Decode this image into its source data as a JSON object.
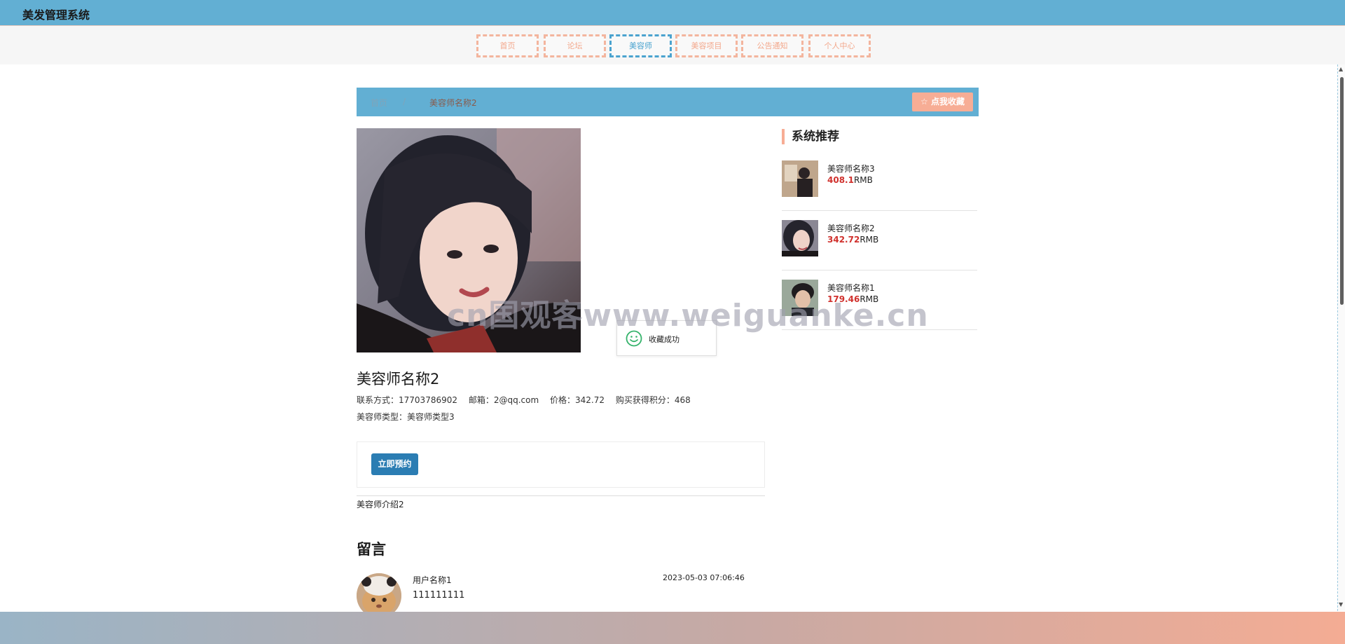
{
  "app": {
    "title": "美发管理系统"
  },
  "nav": {
    "items": [
      {
        "label": "首页",
        "active": false
      },
      {
        "label": "论坛",
        "active": false
      },
      {
        "label": "美容师",
        "active": true
      },
      {
        "label": "美容项目",
        "active": false
      },
      {
        "label": "公告通知",
        "active": false
      },
      {
        "label": "个人中心",
        "active": false
      }
    ]
  },
  "breadcrumb": {
    "home": "首页",
    "separator": "/",
    "current": "美容师名称2"
  },
  "favorite_button": {
    "label": "☆ 点我收藏"
  },
  "detail": {
    "name": "美容师名称2",
    "contact_label": "联系方式：",
    "contact": "17703786902",
    "email_label": "邮箱：",
    "email": "2@qq.com",
    "price_label": "价格：",
    "price": "342.72",
    "points_label": "购买获得积分：",
    "points": "468",
    "type_label": "美容师类型：",
    "type": "美容师类型3",
    "book_label": "立即预约",
    "intro": "美容师介绍2"
  },
  "comments": {
    "title": "留言",
    "items": [
      {
        "user": "用户名称1",
        "text": "111111111",
        "time": "2023-05-03 07:06:46"
      }
    ]
  },
  "sidebar": {
    "title": "系统推荐",
    "currency": "RMB",
    "items": [
      {
        "name": "美容师名称3",
        "price": "408.1"
      },
      {
        "name": "美容师名称2",
        "price": "342.72"
      },
      {
        "name": "美容师名称1",
        "price": "179.46"
      }
    ]
  },
  "toast": {
    "message": "收藏成功"
  },
  "watermark": "cn国观客www.weiguanke.cn",
  "colors": {
    "topbar": "#62afd3",
    "nav_border": "#f3b59e",
    "nav_active": "#4ba3cf",
    "favorite": "#f7ad95",
    "book_button": "#2b7db3",
    "price": "#d0312d"
  }
}
